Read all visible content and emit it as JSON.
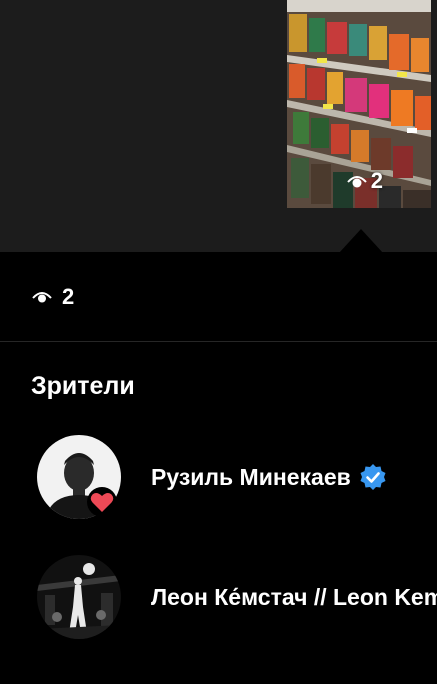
{
  "story": {
    "thumb_view_count": "2"
  },
  "summary": {
    "view_count": "2"
  },
  "viewers_section": {
    "title": "Зрители",
    "viewers": [
      {
        "name": "Рузиль Минекаев",
        "verified": true,
        "liked": true
      },
      {
        "name": "Леон Ке́мстач // Leon Kemstach",
        "verified": false,
        "liked": false
      }
    ]
  },
  "colors": {
    "background": "#000000",
    "top_area": "#1c1c1c",
    "divider": "#262626",
    "verified_blue": "#3897f0",
    "heart_red": "#ed4956"
  },
  "icons": {
    "eye": "eye-icon",
    "verified": "verified-badge-icon",
    "heart": "heart-icon"
  }
}
